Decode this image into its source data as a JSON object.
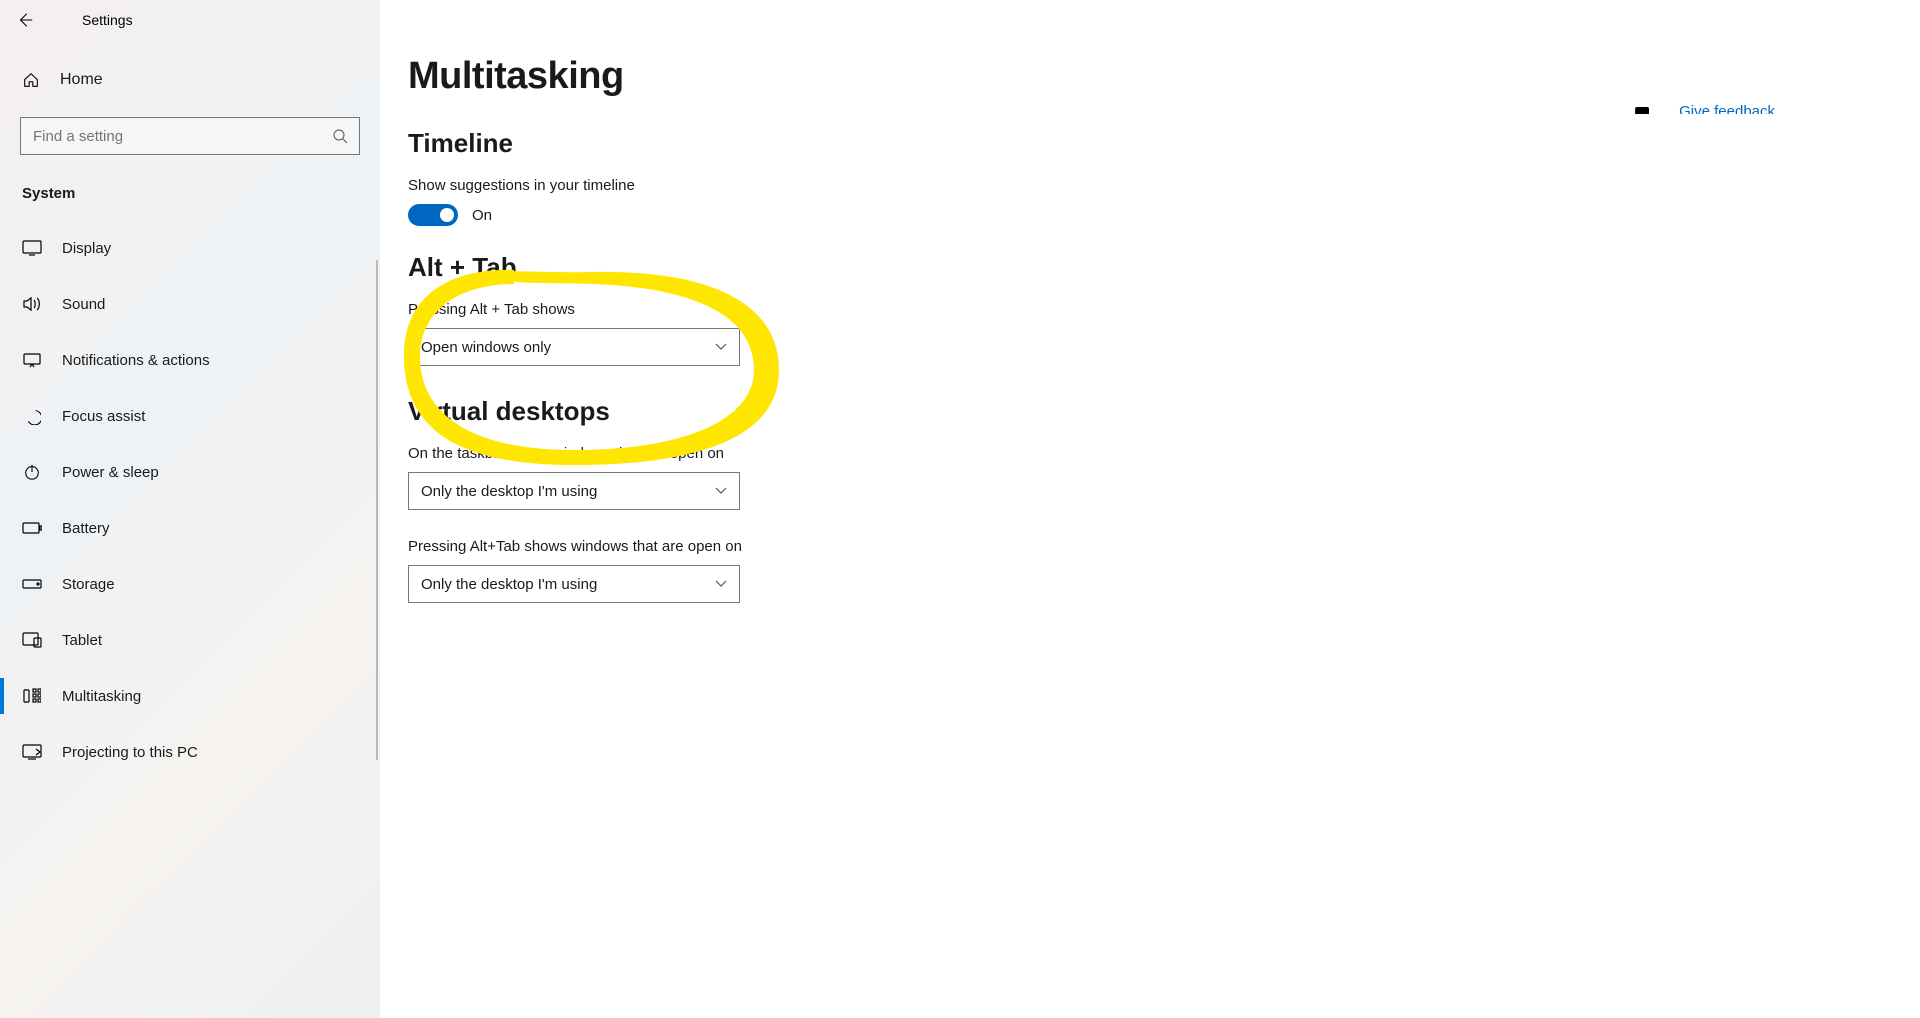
{
  "window": {
    "title": "Settings"
  },
  "sidebar": {
    "home_label": "Home",
    "search_placeholder": "Find a setting",
    "group_label": "System",
    "items": [
      {
        "label": "Display"
      },
      {
        "label": "Sound"
      },
      {
        "label": "Notifications & actions"
      },
      {
        "label": "Focus assist"
      },
      {
        "label": "Power & sleep"
      },
      {
        "label": "Battery"
      },
      {
        "label": "Storage"
      },
      {
        "label": "Tablet"
      },
      {
        "label": "Multitasking"
      },
      {
        "label": "Projecting to this PC"
      }
    ]
  },
  "main": {
    "page_title": "Multitasking",
    "timeline": {
      "heading": "Timeline",
      "toggle_label": "Show suggestions in your timeline",
      "toggle_state_label": "On"
    },
    "alttab": {
      "heading": "Alt + Tab",
      "label": "Pressing Alt + Tab shows",
      "value": "Open windows only"
    },
    "vdesk": {
      "heading": "Virtual desktops",
      "taskbar_label": "On the taskbar, show windows that are open on",
      "taskbar_value": "Only the desktop I'm using",
      "alttab_label": "Pressing Alt+Tab shows windows that are open on",
      "alttab_value": "Only the desktop I'm using"
    }
  },
  "feedback": {
    "link_label": "Give feedback"
  }
}
